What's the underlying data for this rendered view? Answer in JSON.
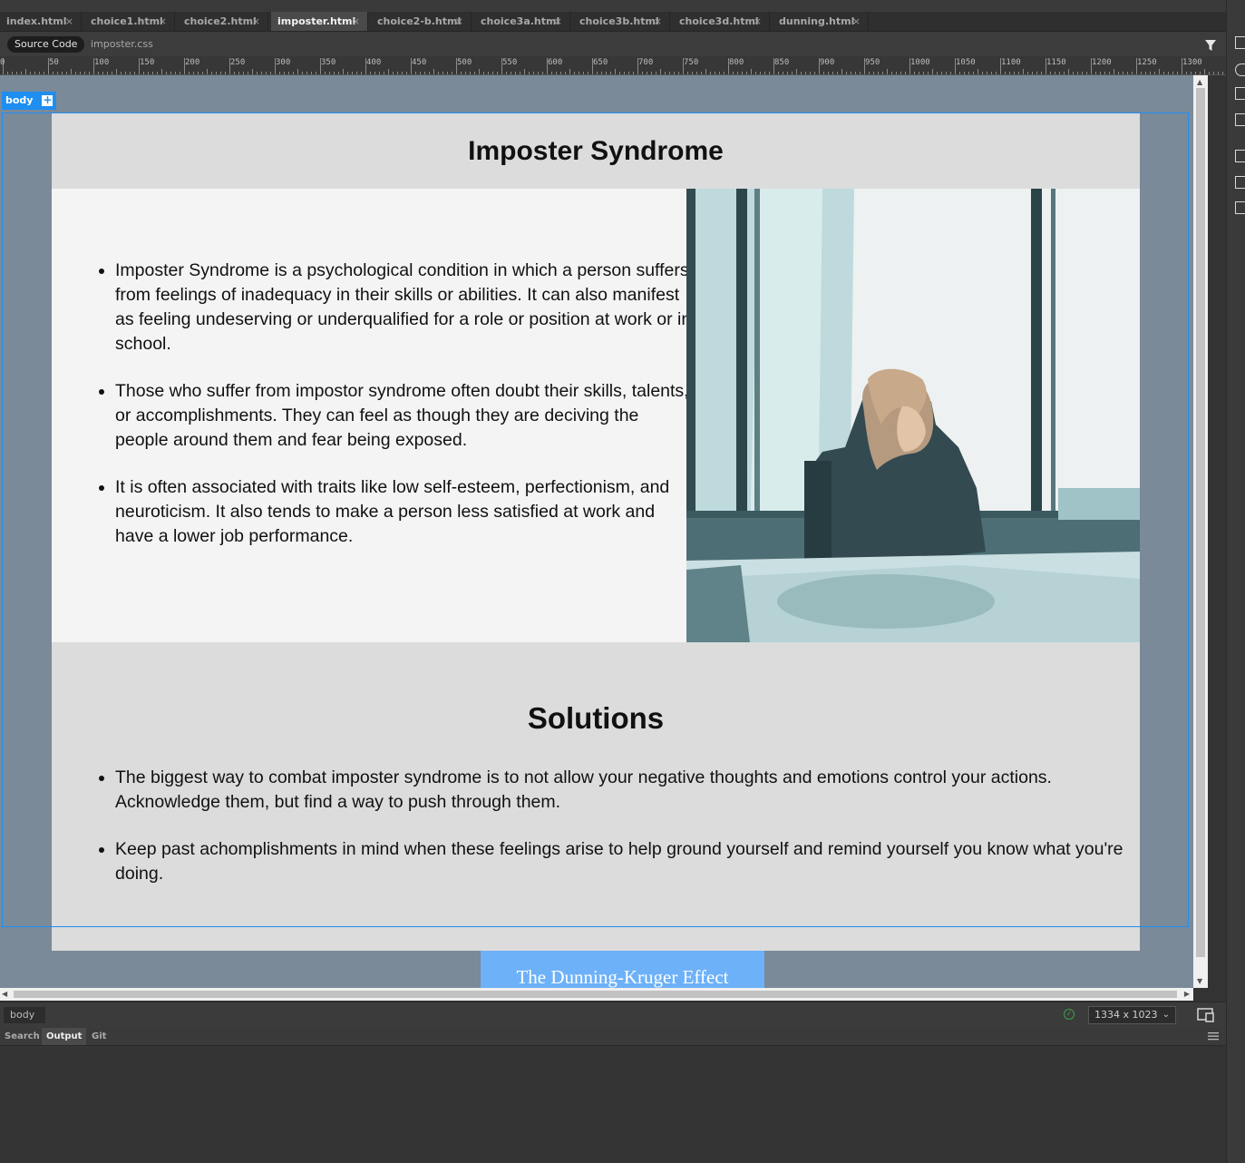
{
  "tabs": [
    {
      "label": "index.html",
      "active": false
    },
    {
      "label": "choice1.html",
      "active": false
    },
    {
      "label": "choice2.html",
      "active": false
    },
    {
      "label": "imposter.html",
      "active": true
    },
    {
      "label": "choice2-b.html",
      "active": false
    },
    {
      "label": "choice3a.html",
      "active": false
    },
    {
      "label": "choice3b.html",
      "active": false
    },
    {
      "label": "choice3d.html",
      "active": false
    },
    {
      "label": "dunning.html",
      "active": false
    }
  ],
  "tab_close_glyph": "×",
  "related_files": {
    "source_code": "Source Code",
    "css_file": "imposter.css"
  },
  "ruler_labels": [
    "0",
    "50",
    "100",
    "150",
    "200",
    "250",
    "300",
    "350",
    "400",
    "450",
    "500",
    "550",
    "600",
    "650",
    "700",
    "750",
    "800",
    "850",
    "900",
    "950",
    "1000",
    "1050",
    "1100",
    "1150",
    "1200",
    "1250",
    "1300"
  ],
  "design": {
    "element_tag": "body",
    "element_add": "+",
    "heading": "Imposter Syndrome",
    "intro_points": [
      "Imposter Syndrome is a psychological condition in which a person suffers from feelings of inadequacy in their skills or abilities. It can also manifest as feeling undeserving or underqualified for a role or position at work or in school.",
      "Those who suffer from impostor syndrome often doubt their skills, talents, or accomplishments. They can feel as though they are deciving the people around them and fear being exposed.",
      "It is often associated with traits like low self-esteem, perfectionism, and neuroticism. It also tends to make a person less satisfied at work and have a lower job performance."
    ],
    "solutions_heading": "Solutions",
    "solution_points": [
      "The biggest way to combat imposter syndrome is to not allow your negative thoughts and emotions control your actions. Acknowledge them, but find a way to push through them.",
      "Keep past achomplishments in mind when these feelings arise to help ground yourself and remind yourself you know what you're doing."
    ],
    "link_button": "The Dunning-Kruger Effect",
    "photo_icon": "woman-at-window-photo"
  },
  "status": {
    "breadcrumb": "body",
    "viewport_size": "1334 x 1023"
  },
  "panel_tabs": [
    {
      "label": "Search",
      "active": false
    },
    {
      "label": "Output",
      "active": true
    },
    {
      "label": "Git",
      "active": false
    }
  ],
  "colors": {
    "selection": "#1e8ef1",
    "design_bg": "#7a8a99",
    "button_bg": "#6db1f8",
    "header_bg": "#dcdcdc",
    "intro_bg": "#f4f4f4"
  }
}
